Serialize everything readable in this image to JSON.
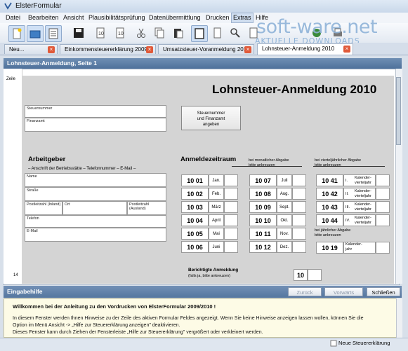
{
  "window": {
    "title": "ElsterFormular"
  },
  "menu": [
    "Datei",
    "Bearbeiten",
    "Ansicht",
    "Plausibilitätsprüfung",
    "Datenübermittlung",
    "Drucken",
    "Extras",
    "Hilfe"
  ],
  "watermark": {
    "main": "soft-ware.net",
    "sub": "AKTUELLE DOWNLOADS"
  },
  "tabs": [
    {
      "label": "Neu..."
    },
    {
      "label": "Einkommensteuererklärung 2009"
    },
    {
      "label": "Umsatzsteuer-Voranmeldung 2010"
    },
    {
      "label": "Lohnsteuer-Anmeldung 2010"
    }
  ],
  "form": {
    "header": "Lohnsteuer-Anmeldung, Seite 1",
    "zeile": "Zeile",
    "line_14": "14",
    "title": "Lohnsteuer-Anmeldung",
    "year": "2010",
    "steuernummer": "Steuernummer",
    "finanzamt": "Finanzamt",
    "btn_steuer": "Steuernummer\nund Finanzamt\nangeben",
    "arbeitgeber": "Arbeitgeber",
    "anschrift": "– Anschrift der Betriebsstätte – Telefonnummer – E-Mail –",
    "name": "Name",
    "strasse": "Straße",
    "postleitzahl_inland": "Postleitzahl (Inland)",
    "ort": "Ort",
    "postleitzahl_ausland": "Postleitzahl (Ausland)",
    "telefon": "Telefon",
    "email": "E-Mail",
    "anmeldezeitraum": "Anmeldezeitraum",
    "monatlich": "bei monatlicher Abgabe\nbitte ankreuzen",
    "vierteljaehrlich": "bei vierteljährlicher Abgabe\nbitte ankreuzen",
    "jaehrlich": "bei jährlicher Abgabe\nbitte ankreuzen",
    "months_col1": [
      {
        "code": "10 01",
        "m": "Jan."
      },
      {
        "code": "10 02",
        "m": "Feb."
      },
      {
        "code": "10 03",
        "m": "März"
      },
      {
        "code": "10 04",
        "m": "April"
      },
      {
        "code": "10 05",
        "m": "Mai"
      },
      {
        "code": "10 06",
        "m": "Juni"
      }
    ],
    "months_col2": [
      {
        "code": "10 07",
        "m": "Juli"
      },
      {
        "code": "10 08",
        "m": "Aug."
      },
      {
        "code": "10 09",
        "m": "Sept."
      },
      {
        "code": "10 10",
        "m": "Okt."
      },
      {
        "code": "10 11",
        "m": "Nov."
      },
      {
        "code": "10 12",
        "m": "Dez."
      }
    ],
    "quarters": [
      {
        "code": "10 41",
        "q": "I.",
        "t": "Kalender-\nvierteljahr"
      },
      {
        "code": "10 42",
        "q": "II.",
        "t": "Kalender-\nvierteljahr"
      },
      {
        "code": "10 43",
        "q": "III.",
        "t": "Kalender-\nvierteljahr"
      },
      {
        "code": "10 44",
        "q": "IV.",
        "t": "Kalender-\nvierteljahr"
      }
    ],
    "jahr": {
      "code": "10 19",
      "t": "Kalender-\njahr"
    },
    "berichtigte": "Berichtigte Anmeldung",
    "berichtigte_sub": "(falls ja, bitte ankreuzen)",
    "code_10": "10"
  },
  "help": {
    "title": "Eingabehilfe",
    "btn_back": "Zurück",
    "btn_forward": "Vorwärts",
    "btn_close": "Schließen",
    "heading": "Willkommen bei der Anleitung zu den Vordrucken von ElsterFormular 2009/2010 !",
    "line1": "In diesem Fenster werden Ihnen Hinweise zu der Zeile des aktiven Formular Feldes angezeigt. Wenn Sie keine Hinweise anzeigen lassen wollen, können Sie die",
    "line2": "Option im Menü Ansicht -> „Hilfe zur Steuererklärung anzeigen\" deaktivieren.",
    "line3": "Dieses Fenster kann durch Ziehen der Fensterleiste „Hilfe zur Steuererklärung\" vergrößert oder verkleinert werden."
  },
  "status": {
    "new_decl": "Neue Steuererklärung"
  }
}
